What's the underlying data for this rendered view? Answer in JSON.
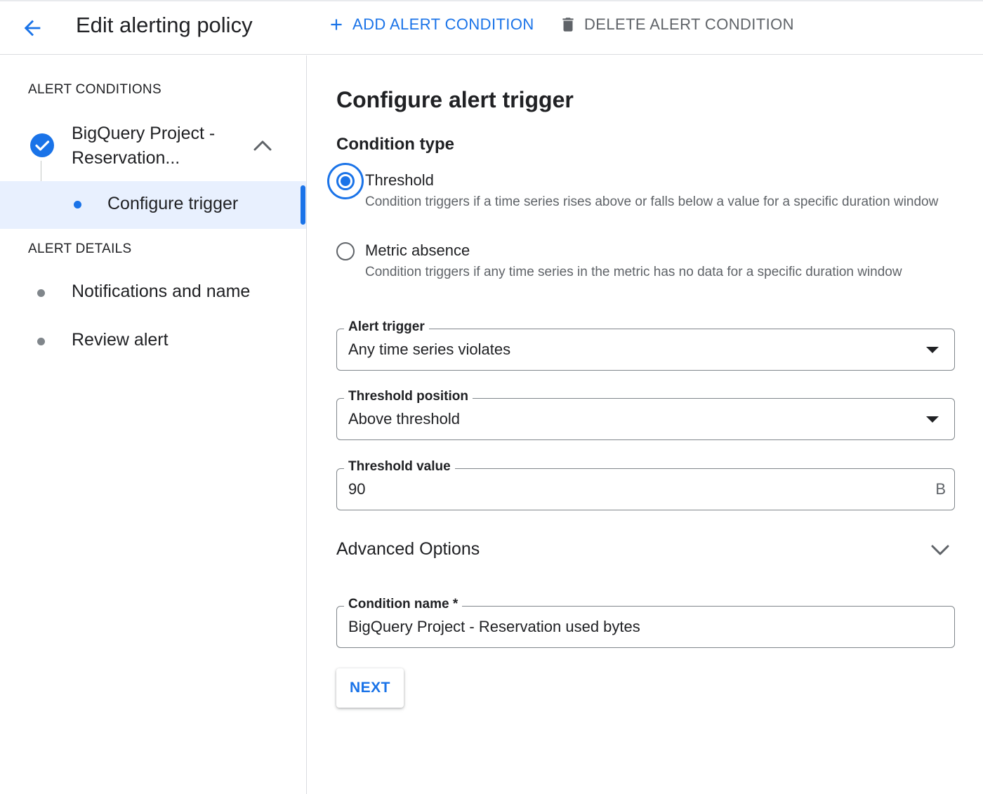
{
  "header": {
    "title": "Edit alerting policy",
    "add_condition_label": "ADD ALERT CONDITION",
    "delete_condition_label": "DELETE ALERT CONDITION"
  },
  "sidebar": {
    "conditions_heading": "ALERT CONDITIONS",
    "condition_item": {
      "label": "BigQuery Project - Reservation...",
      "status": "complete"
    },
    "sub_item": {
      "label": "Configure trigger"
    },
    "details_heading": "ALERT DETAILS",
    "detail_items": [
      {
        "label": "Notifications and name"
      },
      {
        "label": "Review alert"
      }
    ]
  },
  "main": {
    "title": "Configure alert trigger",
    "condition_type_label": "Condition type",
    "options": [
      {
        "label": "Threshold",
        "description": "Condition triggers if a time series rises above or falls below a value for a specific duration window",
        "selected": true
      },
      {
        "label": "Metric absence",
        "description": "Condition triggers if any time series in the metric has no data for a specific duration window",
        "selected": false
      }
    ],
    "alert_trigger": {
      "label": "Alert trigger",
      "value": "Any time series violates"
    },
    "threshold_position": {
      "label": "Threshold position",
      "value": "Above threshold"
    },
    "threshold_value": {
      "label": "Threshold value",
      "value": "90",
      "unit": "B"
    },
    "advanced_options_label": "Advanced Options",
    "condition_name": {
      "label": "Condition name *",
      "value": "BigQuery Project - Reservation used bytes"
    },
    "next_label": "NEXT"
  },
  "colors": {
    "accent": "#1a73e8",
    "active_bg": "#e8f0fe",
    "text": "#202124",
    "muted": "#5f6368"
  }
}
